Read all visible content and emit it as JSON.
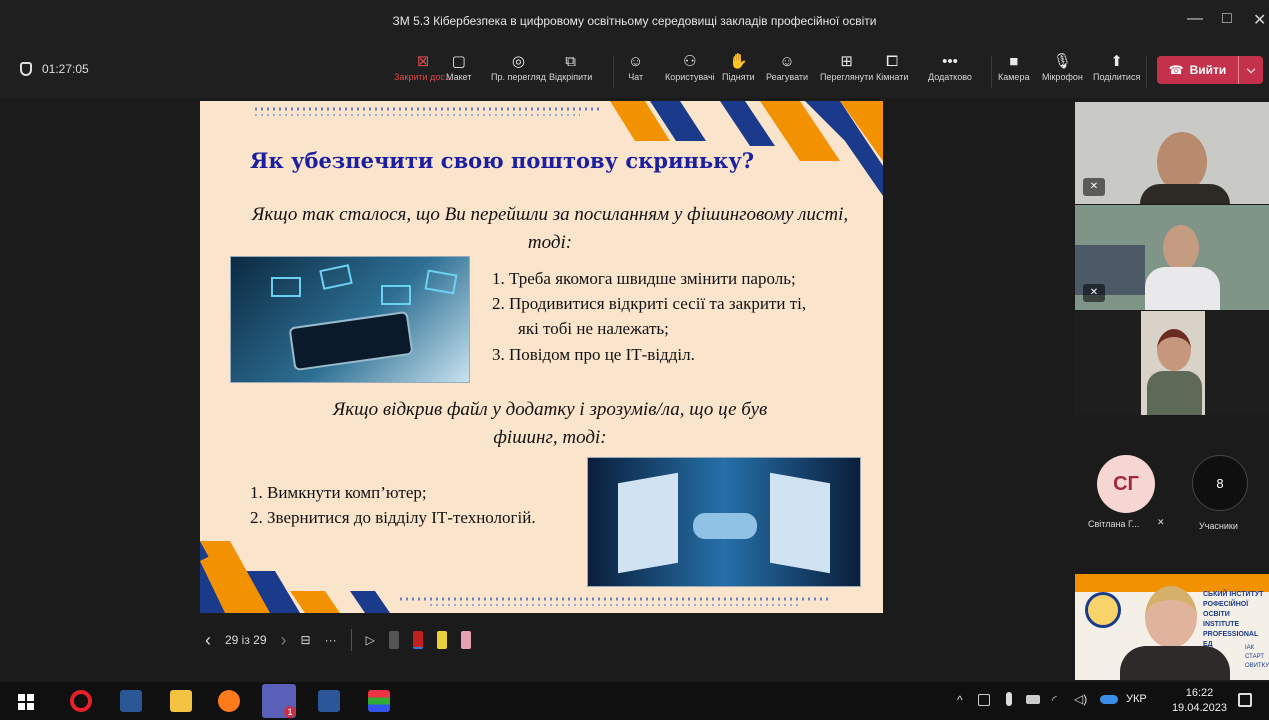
{
  "window": {
    "title": "ЗМ 5.3 Кібербезпека в цифровому освітньому середовищі закладів професійної освіти",
    "minimize": "—",
    "maximize": "□",
    "close": "✕"
  },
  "meeting": {
    "elapsed": "01:27:05"
  },
  "toolbar": {
    "items": [
      {
        "label": "Закрити дос...",
        "icon": "close-share-icon",
        "glyph": "⊠"
      },
      {
        "label": "Макет",
        "icon": "layout-icon",
        "glyph": "▢"
      },
      {
        "label": "Пр. перегляд",
        "icon": "eye-icon",
        "glyph": "◎"
      },
      {
        "label": "Відкріпити",
        "icon": "popout-icon",
        "glyph": "⧉"
      },
      {
        "label": "Чат",
        "icon": "chat-icon",
        "glyph": "☺"
      },
      {
        "label": "Користувачі",
        "icon": "people-icon",
        "glyph": "⚇"
      },
      {
        "label": "Підняти",
        "icon": "raise-hand-icon",
        "glyph": "✋"
      },
      {
        "label": "Реагувати",
        "icon": "react-icon",
        "glyph": "☺"
      },
      {
        "label": "Переглянути",
        "icon": "view-icon",
        "glyph": "⊞"
      },
      {
        "label": "Кімнати",
        "icon": "rooms-icon",
        "glyph": "⧠"
      },
      {
        "label": "Додатково",
        "icon": "more-icon",
        "glyph": "•••"
      },
      {
        "label": "Камера",
        "icon": "camera-icon",
        "glyph": "■"
      },
      {
        "label": "Мікрофон",
        "icon": "microphone-icon",
        "glyph": "🎙"
      },
      {
        "label": "Поділитися",
        "icon": "share-icon",
        "glyph": "⬆"
      }
    ],
    "leave_label": "Вийти",
    "leave_phone": "☎",
    "leave_chevron": "⌵"
  },
  "slide": {
    "title": "Як убезпечити свою поштову скриньку?",
    "intro1": "Якщо так сталося, що Ви перейшли за посиланням у фішинговому листі, тоді:",
    "list1": [
      "1.  Треба якомога швидше змінити пароль;",
      "2.  Продивитися відкриті сесії та закрити ті,",
      "які тобі не належать;",
      "3.  Повідом про це ІТ-відділ."
    ],
    "intro2": "Якщо відкрив файл у додатку і зрозумів/ла, що це був фішинг, тоді:",
    "list2": [
      "1.  Вимкнути комп’ютер;",
      "2.  Звернитися до відділу ІТ-технологій."
    ]
  },
  "slide_controls": {
    "prev": "‹",
    "position": "29 із 29",
    "next": "›",
    "grid": "⊟",
    "more": "···",
    "pointer": "▷"
  },
  "participants": {
    "avatar_initials": "СГ",
    "avatar_name": "Світлана Г...",
    "count": "8",
    "count_label": "Учасники",
    "muted_glyph": "✕"
  },
  "institute_banner": {
    "line1": "СЬКИЙ ІНСТИТУТ",
    "line2": "РОФЕСІЙНОЇ ОСВІТИ",
    "line3": "INSTITUTE",
    "line4": "PROFESSIONAL",
    "line5": "ЕД",
    "line6": "ІАК СТАРТ",
    "line7": "ОВИТКУ"
  },
  "taskbar": {
    "tray_arrow": "^",
    "language": "УКР",
    "time": "16:22",
    "date": "19.04.2023",
    "teams_badge": "1"
  },
  "colors": {
    "accent_red": "#c4314b",
    "slide_bg": "#fbe4cc",
    "title_blue": "#1b1fa0",
    "orange": "#f39200",
    "navy": "#1a3a8c"
  }
}
